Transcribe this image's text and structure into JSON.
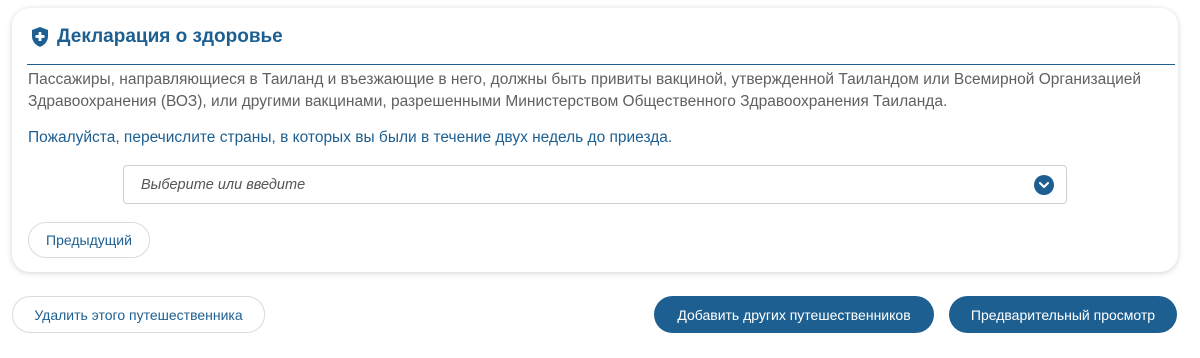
{
  "section": {
    "title": "Декларация о здоровье",
    "icon": "shield-plus-icon",
    "notice": "Пассажиры, направляющиеся в Таиланд и въезжающие в него, должны быть привиты вакциной, утвержденной Таиландом или Всемирной Организацией Здравоохранения (ВОЗ), или другими вакцинами, разрешенными Министерством Общественного Здравоохранения Таиланда.",
    "instruction": "Пожалуйста, перечислите страны, в которых вы были в течение двух недель до приезда."
  },
  "countries_select": {
    "placeholder": "Выберите или введите",
    "icon": "chevron-down-icon"
  },
  "buttons": {
    "previous": "Предыдущий",
    "delete_traveler": "Удалить этого путешественника",
    "add_travelers": "Добавить других путешественников",
    "preview": "Предварительный просмотр"
  },
  "colors": {
    "accent": "#1d5f91",
    "body_text": "#606060"
  }
}
